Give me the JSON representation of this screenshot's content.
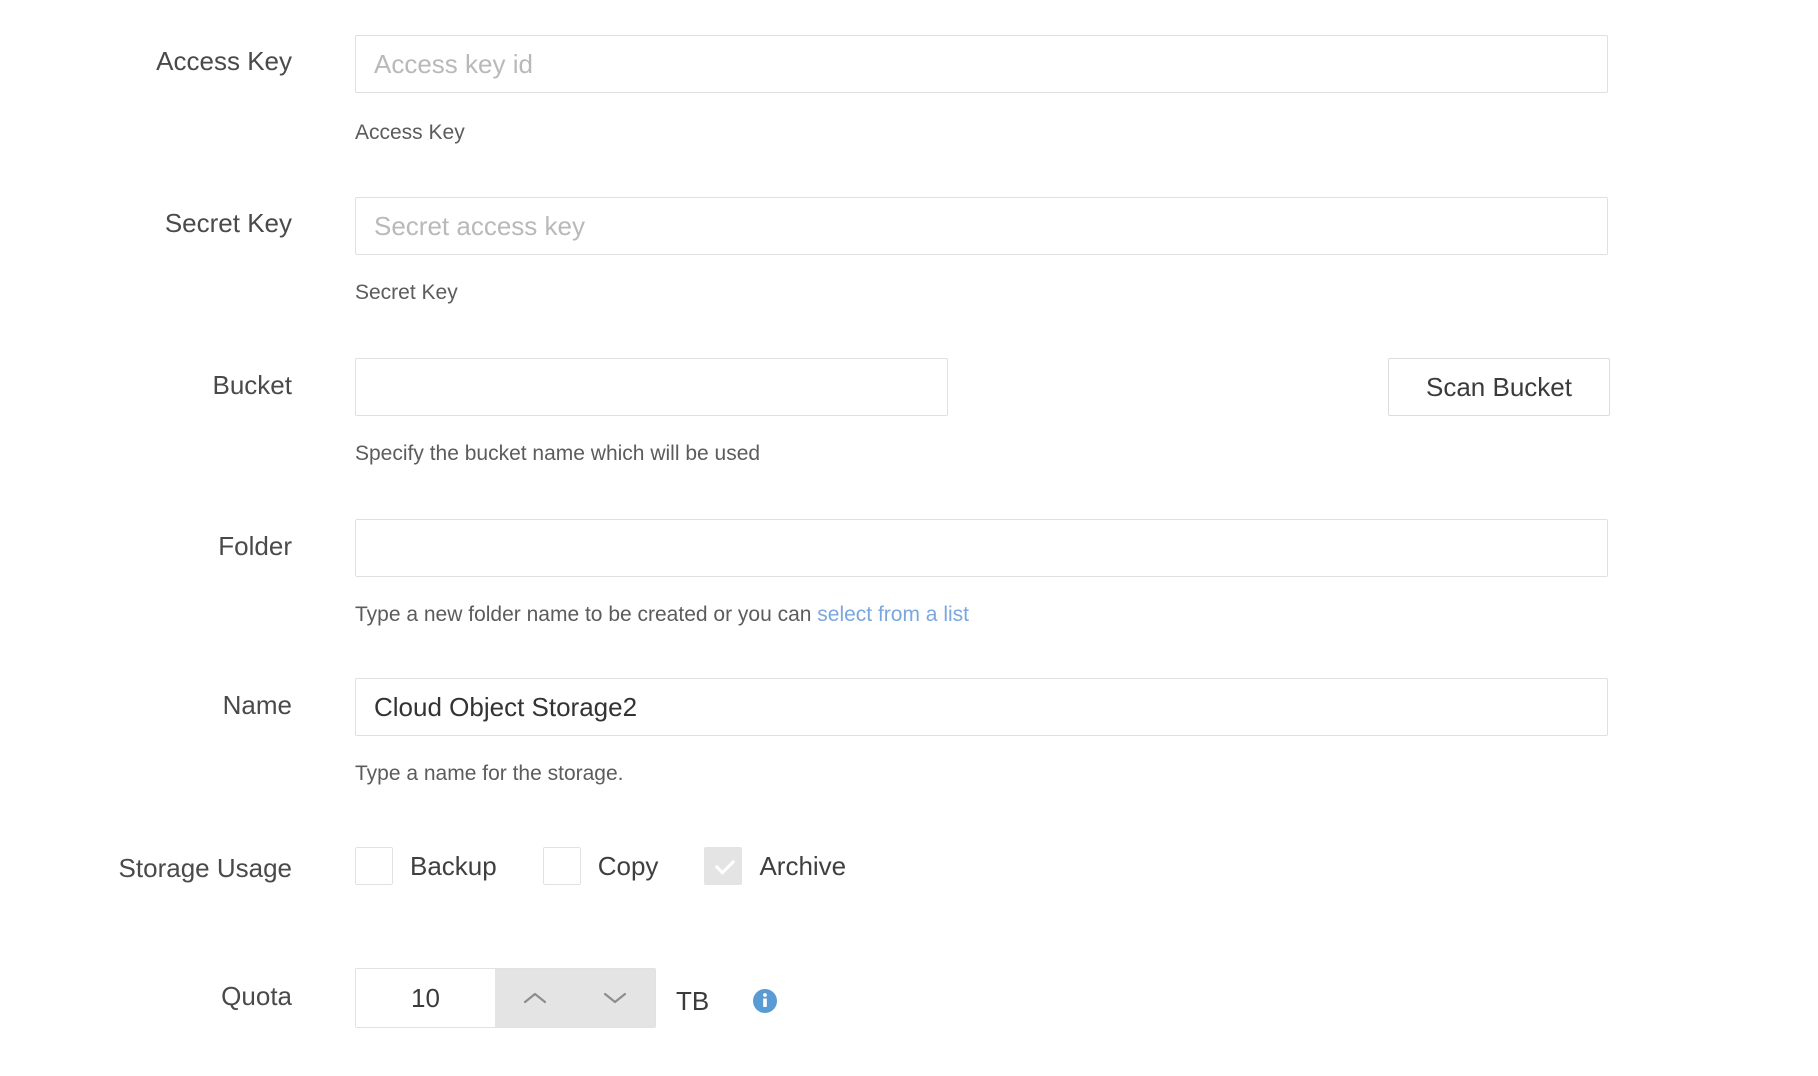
{
  "form": {
    "fields": {
      "access_key": {
        "label": "Access Key",
        "placeholder": "Access key id",
        "value": "",
        "help": "Access Key"
      },
      "secret_key": {
        "label": "Secret Key",
        "placeholder": "Secret access key",
        "value": "",
        "help": "Secret Key"
      },
      "bucket": {
        "label": "Bucket",
        "placeholder": "",
        "value": "",
        "help": "Specify the bucket name which will be used",
        "scan_button": "Scan Bucket"
      },
      "folder": {
        "label": "Folder",
        "placeholder": "",
        "value": "",
        "help_prefix": "Type a new folder name to be created or you can ",
        "help_link": "select from a list"
      },
      "name": {
        "label": "Name",
        "placeholder": "",
        "value": "Cloud Object Storage2",
        "help": "Type a name for the storage."
      },
      "storage_usage": {
        "label": "Storage Usage",
        "options": [
          {
            "label": "Backup",
            "checked": false,
            "disabled": false
          },
          {
            "label": "Copy",
            "checked": false,
            "disabled": false
          },
          {
            "label": "Archive",
            "checked": true,
            "disabled": true
          }
        ]
      },
      "quota": {
        "label": "Quota",
        "value": "10",
        "unit": "TB",
        "increment_icon": "chevron-up-icon",
        "decrement_icon": "chevron-down-icon",
        "info_icon": "info-icon"
      }
    }
  },
  "colors": {
    "link": "#7aa7dd",
    "info_icon": "#5b9bd5",
    "border": "#e0e0e0",
    "text": "#3b3b3b",
    "muted": "#5c5c5c",
    "placeholder": "#b9b9b9",
    "disabled_fill": "#e4e4e4"
  }
}
